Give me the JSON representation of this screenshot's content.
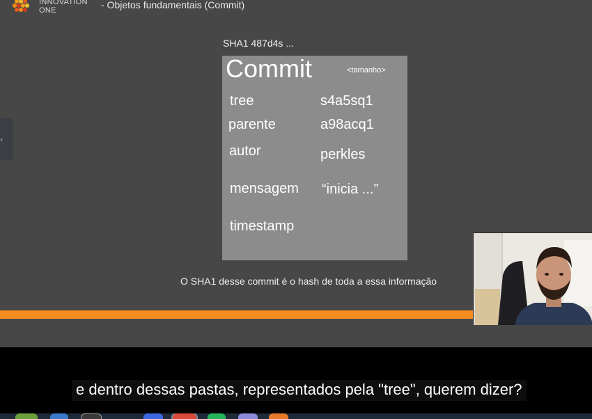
{
  "header": {
    "brand_line1": "INNOVATION",
    "brand_line2": "ONE",
    "slide_title": "- Objetos fundamentais (Commit)"
  },
  "slide": {
    "sha_label": "SHA1 487d4s ...",
    "commit": {
      "title": "Commit",
      "size_label": "<tamanho>",
      "fields": [
        {
          "key": "tree",
          "value": "s4a5sq1"
        },
        {
          "key": "parente",
          "value": "a98acq1"
        },
        {
          "key": "autor",
          "value": "perkles"
        },
        {
          "key": "mensagem",
          "value": "“inicia ...”"
        },
        {
          "key": "timestamp",
          "value": ""
        }
      ]
    },
    "caption": "O SHA1 desse commit é o hash de toda a essa informação"
  },
  "player": {
    "progress_fraction": 0.8,
    "subtitle": "e dentro dessas pastas, representados pela \"tree\", querem dizer?"
  },
  "colors": {
    "slide_bg": "#474747",
    "commit_box": "#8c8c8c",
    "progress": "#f78d1e",
    "subtitle_bg": "#000000"
  },
  "icons": {
    "logo": "hexagon-grid-logo-icon",
    "side_tab": "chevron-left-icon",
    "webcam": "presenter-webcam"
  }
}
